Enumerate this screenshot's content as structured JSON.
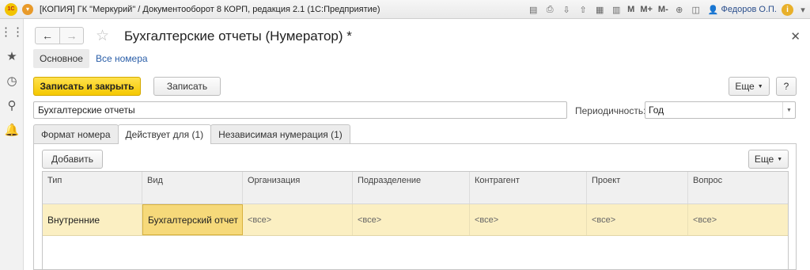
{
  "window": {
    "title": "[КОПИЯ] ГК \"Меркурий\" / Документооборот 8 КОРП, редакция 2.1   (1С:Предприятие)",
    "logo_text": "1С",
    "user": "Федоров О.П.",
    "toolbar_labels": {
      "m": "M",
      "m_plus": "M+",
      "m_minus": "M-"
    }
  },
  "form": {
    "title": "Бухгалтерские отчеты (Нумератор) *",
    "sections": [
      "Основное",
      "Все номера"
    ],
    "commands": {
      "save_close": "Записать и закрыть",
      "save": "Записать",
      "more": "Еще",
      "help": "?"
    },
    "name_value": "Бухгалтерские отчеты",
    "periodicity_label": "Периодичность:",
    "periodicity_value": "Год",
    "tabs": [
      "Формат номера",
      "Действует для (1)",
      "Независимая нумерация (1)"
    ],
    "active_tab_index": 1,
    "table": {
      "add_button": "Добавить",
      "more_button": "Еще",
      "columns": [
        "Тип",
        "Вид",
        "Организация",
        "Подразделение",
        "Контрагент",
        "Проект",
        "Вопрос"
      ],
      "rows": [
        [
          "Внутренние",
          "Бухгалтерский отчет",
          "<все>",
          "<все>",
          "<все>",
          "<все>",
          "<все>"
        ]
      ]
    }
  }
}
